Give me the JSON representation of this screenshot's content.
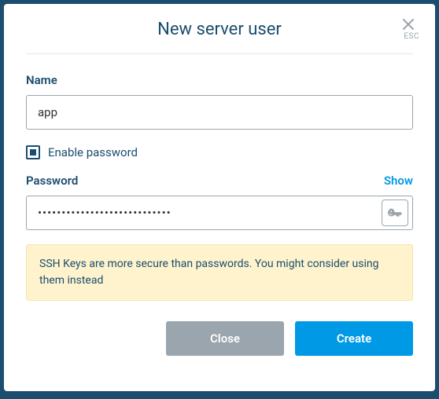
{
  "modal": {
    "title": "New server user",
    "esc_label": "ESC"
  },
  "fields": {
    "name_label": "Name",
    "name_value": "app",
    "enable_password_label": "Enable password",
    "enable_password_checked": true,
    "password_label": "Password",
    "show_label": "Show",
    "password_value": "••••••••••••••••••••••••••••"
  },
  "banner": {
    "text": "SSH Keys are more secure than passwords. You might consider using them instead"
  },
  "buttons": {
    "close_label": "Close",
    "create_label": "Create"
  }
}
